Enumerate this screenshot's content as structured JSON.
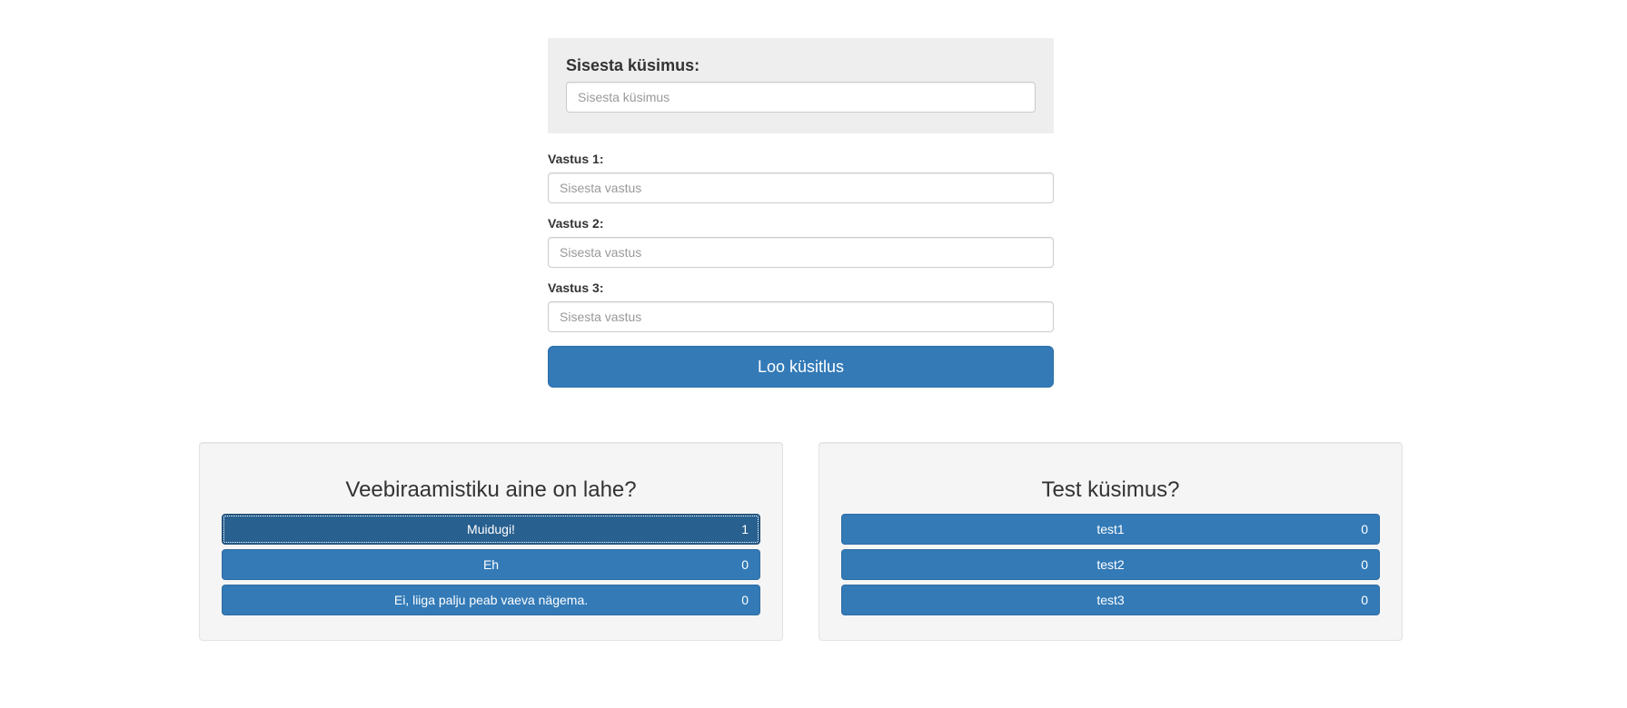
{
  "form": {
    "question_label": "Sisesta küsimus:",
    "question_placeholder": "Sisesta küsimus",
    "answers": [
      {
        "label": "Vastus 1:",
        "placeholder": "Sisesta vastus"
      },
      {
        "label": "Vastus 2:",
        "placeholder": "Sisesta vastus"
      },
      {
        "label": "Vastus 3:",
        "placeholder": "Sisesta vastus"
      }
    ],
    "submit_label": "Loo küsitlus"
  },
  "polls": [
    {
      "title": "Veebiraamistiku aine on lahe?",
      "options": [
        {
          "label": "Muidugi!",
          "count": "1"
        },
        {
          "label": "Eh",
          "count": "0"
        },
        {
          "label": "Ei, liiga palju peab vaeva nägema.",
          "count": "0"
        }
      ]
    },
    {
      "title": "Test küsimus?",
      "options": [
        {
          "label": "test1",
          "count": "0"
        },
        {
          "label": "test2",
          "count": "0"
        },
        {
          "label": "test3",
          "count": "0"
        }
      ]
    }
  ],
  "colors": {
    "primary": "#337ab7",
    "primary_active": "#286090",
    "panel_bg": "#eeeeee",
    "card_bg": "#f5f5f5"
  }
}
